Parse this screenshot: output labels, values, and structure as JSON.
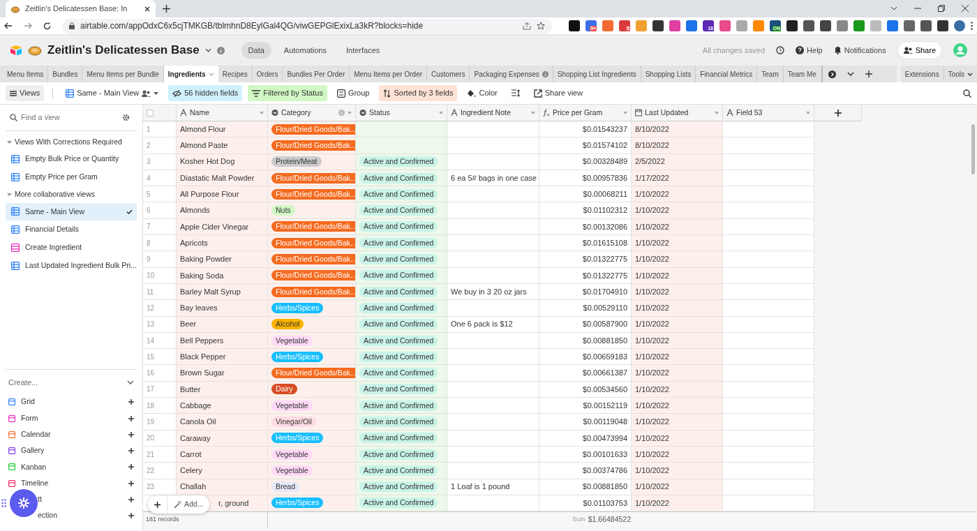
{
  "browser": {
    "tab_title": "Zeitlin's Delicatessen Base: In",
    "url": "airtable.com/appOdxC6x5cjTMKGB/tblmhnD8EylGal4QG/viwGEPGlExixLa3kR?blocks=hide",
    "extensions": [
      {
        "color": "#111111"
      },
      {
        "color": "#3b6ee8",
        "badge": "9+"
      },
      {
        "color": "#f36b32"
      },
      {
        "color": "#d93b3b",
        "badge": "5"
      },
      {
        "color": "#f0a030"
      },
      {
        "color": "#333333"
      },
      {
        "color": "#e040a0"
      },
      {
        "color": "#1a73e8"
      },
      {
        "color": "#5b2bb5",
        "badge": "18"
      },
      {
        "color": "#e84a8a"
      },
      {
        "color": "#aaaaaa"
      },
      {
        "color": "#ff8800"
      },
      {
        "color": "#1a5080",
        "badge": "ON"
      },
      {
        "color": "#222222"
      },
      {
        "color": "#555555"
      },
      {
        "color": "#444444"
      },
      {
        "color": "#888888"
      },
      {
        "color": "#1a9a1a"
      },
      {
        "color": "#bbbbbb"
      },
      {
        "color": "#1a73e8"
      },
      {
        "color": "#666666"
      },
      {
        "color": "#555556"
      },
      {
        "color": "#333334"
      },
      {
        "color": "#3a6ea5"
      }
    ]
  },
  "app": {
    "base_title": "Zeitlin's Delicatessen Base",
    "nav": [
      {
        "label": "Data",
        "selected": true
      },
      {
        "label": "Automations",
        "selected": false
      },
      {
        "label": "Interfaces",
        "selected": false
      }
    ],
    "save_status": "All changes saved",
    "help": "Help",
    "notifications": "Notifications",
    "share": "Share"
  },
  "tables": [
    {
      "label": "Menu Items",
      "selected": false
    },
    {
      "label": "Bundles",
      "selected": false
    },
    {
      "label": "Menu Items per Bundle",
      "selected": false
    },
    {
      "label": "Ingredients",
      "selected": true
    },
    {
      "label": "Recipes",
      "selected": false
    },
    {
      "label": "Orders",
      "selected": false
    },
    {
      "label": "Bundles Per Order",
      "selected": false
    },
    {
      "label": "Menu Items per Order",
      "selected": false
    },
    {
      "label": "Customers",
      "selected": false
    },
    {
      "label": "Packaging Expenses",
      "selected": false,
      "info": true
    },
    {
      "label": "Shopping List Ingredients",
      "selected": false
    },
    {
      "label": "Shopping Lists",
      "selected": false
    },
    {
      "label": "Financial Metrics",
      "selected": false
    },
    {
      "label": "Team",
      "selected": false
    },
    {
      "label": "Team Me",
      "selected": false
    }
  ],
  "table_tools": [
    "Extensions",
    "Tools"
  ],
  "toolbar": {
    "views": "Views",
    "current_view": "Same - Main View",
    "buttons": [
      {
        "kind": "hidden",
        "label": "56 hidden fields"
      },
      {
        "kind": "filter",
        "label": "Filtered by Status"
      },
      {
        "kind": "group",
        "label": "Group"
      },
      {
        "kind": "sort",
        "label": "Sorted by 3 fields"
      },
      {
        "kind": "color",
        "label": "Color"
      },
      {
        "kind": "height"
      },
      {
        "kind": "share",
        "label": "Share view"
      }
    ]
  },
  "sidebar": {
    "search": {
      "placeholder": "Find a view"
    },
    "sections": [
      {
        "title": "Views With Corrections Required",
        "expanded": true,
        "views": [
          {
            "kind": "grid",
            "label": "Empty Bulk Price or Quantity",
            "selected": false
          },
          {
            "kind": "grid",
            "label": "Empty Price per Gram",
            "selected": false
          }
        ]
      },
      {
        "title": "More collaborative views",
        "expanded": true,
        "views": [
          {
            "kind": "grid",
            "label": "Same - Main View",
            "selected": true
          },
          {
            "kind": "grid",
            "label": "Financial Details",
            "selected": false
          },
          {
            "kind": "form",
            "label": "Create Ingredient",
            "selected": false
          },
          {
            "kind": "grid",
            "label": "Last Updated Ingredient Bulk Pri...",
            "selected": false
          }
        ]
      }
    ],
    "create": {
      "title": "Create...",
      "items": [
        {
          "label": "Grid",
          "color": "#2d7ff9"
        },
        {
          "label": "Form",
          "color": "#e929ba"
        },
        {
          "label": "Calendar",
          "color": "#ff6f2c"
        },
        {
          "label": "Gallery",
          "color": "#7c39ed"
        },
        {
          "label": "Kanban",
          "color": "#20c933"
        },
        {
          "label": "Timeline",
          "color": "#f82b60"
        },
        {
          "label": "tt"
        },
        {
          "label": "ection"
        }
      ]
    }
  },
  "table": {
    "columns": [
      {
        "kind": "text",
        "label": "Name"
      },
      {
        "kind": "select",
        "label": "Category",
        "info": true
      },
      {
        "kind": "select",
        "label": "Status"
      },
      {
        "kind": "text",
        "label": "Ingredient Note"
      },
      {
        "kind": "formula",
        "label": "Price per Gram"
      },
      {
        "kind": "date",
        "label": "Last Updated"
      },
      {
        "kind": "text",
        "label": "Field 53"
      }
    ],
    "rows": [
      {
        "number": "1",
        "name": "Almond Flour",
        "category": {
          "label": "Flour/Dried Goods/Bak...",
          "color": "#f56a1f"
        },
        "price": "$0.01543237",
        "updated": "8/10/2022"
      },
      {
        "number": "2",
        "name": "Almond Paste",
        "category": {
          "label": "Flour/Dried Goods/Bak...",
          "color": "#f56a1f"
        },
        "price": "$0.01574102",
        "updated": "8/10/2022"
      },
      {
        "number": "3",
        "name": "Kosher Hot Dog",
        "category": {
          "label": "Protein/Meat",
          "color": "#cccccc"
        },
        "status": "Active and Confirmed",
        "price": "$0.00328489",
        "updated": "2/5/2022"
      },
      {
        "number": "4",
        "name": "Diastatic Malt Powder",
        "category": {
          "label": "Flour/Dried Goods/Bak...",
          "color": "#f56a1f"
        },
        "status": "Active and Confirmed",
        "note": "6 ea 5# bags in one case",
        "price": "$0.00957836",
        "updated": "1/17/2022"
      },
      {
        "number": "5",
        "name": "All Purpose Flour",
        "category": {
          "label": "Flour/Dried Goods/Bak...",
          "color": "#f56a1f"
        },
        "status": "Active and Confirmed",
        "price": "$0.00068211",
        "updated": "1/10/2022"
      },
      {
        "number": "6",
        "name": "Almonds",
        "category": {
          "label": "Nuts",
          "color": "#d1f7c4"
        },
        "status": "Active and Confirmed",
        "price": "$0.01102312",
        "updated": "1/10/2022"
      },
      {
        "number": "7",
        "name": "Apple Cider Vinegar",
        "category": {
          "label": "Flour/Dried Goods/Bak...",
          "color": "#f56a1f"
        },
        "status": "Active and Confirmed",
        "price": "$0.00132086",
        "updated": "1/10/2022"
      },
      {
        "number": "8",
        "name": "Apricots",
        "category": {
          "label": "Flour/Dried Goods/Bak...",
          "color": "#f56a1f"
        },
        "status": "Active and Confirmed",
        "price": "$0.01615108",
        "updated": "1/10/2022"
      },
      {
        "number": "9",
        "name": "Baking Powder",
        "category": {
          "label": "Flour/Dried Goods/Bak...",
          "color": "#f56a1f"
        },
        "status": "Active and Confirmed",
        "price": "$0.01322775",
        "updated": "1/10/2022"
      },
      {
        "number": "10",
        "name": "Baking Soda",
        "category": {
          "label": "Flour/Dried Goods/Bak...",
          "color": "#f56a1f"
        },
        "status": "Active and Confirmed",
        "price": "$0.01322775",
        "updated": "1/10/2022"
      },
      {
        "number": "11",
        "name": "Barley Malt Syrup",
        "category": {
          "label": "Flour/Dried Goods/Bak...",
          "color": "#f56a1f"
        },
        "status": "Active and Confirmed",
        "note": "We buy in 3 20 oz jars",
        "price": "$0.01704910",
        "updated": "1/10/2022"
      },
      {
        "number": "12",
        "name": "Bay leaves",
        "category": {
          "label": "Herbs/Spices",
          "color": "#18bfff"
        },
        "status": "Active and Confirmed",
        "price": "$0.00529110",
        "updated": "1/10/2022"
      },
      {
        "number": "13",
        "name": "Beer",
        "category": {
          "label": "Alcohol",
          "color": "#fcb400"
        },
        "status": "Active and Confirmed",
        "note": "One 6 pack is $12",
        "price": "$0.00587900",
        "updated": "1/10/2022"
      },
      {
        "number": "14",
        "name": "Bell Peppers",
        "category": {
          "label": "Vegetable",
          "color": "#ffdaf6"
        },
        "status": "Active and Confirmed",
        "price": "$0.00881850",
        "updated": "1/10/2022"
      },
      {
        "number": "15",
        "name": "Black Pepper",
        "category": {
          "label": "Herbs/Spices",
          "color": "#18bfff"
        },
        "status": "Active and Confirmed",
        "price": "$0.00659183",
        "updated": "1/10/2022"
      },
      {
        "number": "16",
        "name": "Brown Sugar",
        "category": {
          "label": "Flour/Dried Goods/Bak...",
          "color": "#f56a1f"
        },
        "status": "Active and Confirmed",
        "price": "$0.00661387",
        "updated": "1/10/2022"
      },
      {
        "number": "17",
        "name": "Butter",
        "category": {
          "label": "Dairy",
          "color": "#d74d26"
        },
        "status": "Active and Confirmed",
        "price": "$0.00534560",
        "updated": "1/10/2022"
      },
      {
        "number": "18",
        "name": "Cabbage",
        "category": {
          "label": "Vegetable",
          "color": "#ffdaf6"
        },
        "status": "Active and Confirmed",
        "price": "$0.00152119",
        "updated": "1/10/2022"
      },
      {
        "number": "19",
        "name": "Canola Oil",
        "category": {
          "label": "Vinegar/Oil",
          "color": "#ffdce5"
        },
        "status": "Active and Confirmed",
        "price": "$0.00119048",
        "updated": "1/10/2022"
      },
      {
        "number": "20",
        "name": "Caraway",
        "category": {
          "label": "Herbs/Spices",
          "color": "#18bfff"
        },
        "status": "Active and Confirmed",
        "price": "$0.00473994",
        "updated": "1/10/2022"
      },
      {
        "number": "21",
        "name": "Carrot",
        "category": {
          "label": "Vegetable",
          "color": "#ffdaf6"
        },
        "status": "Active and Confirmed",
        "price": "$0.00101633",
        "updated": "1/10/2022"
      },
      {
        "number": "22",
        "name": "Celery",
        "category": {
          "label": "Vegetable",
          "color": "#ffdaf6"
        },
        "status": "Active and Confirmed",
        "price": "$0.00374786",
        "updated": "1/10/2022"
      },
      {
        "number": "23",
        "name": "Challah",
        "category": {
          "label": "Bread",
          "color": "#e5e9f7"
        },
        "status": "Active and Confirmed",
        "note": "1 Loaf is 1 pound",
        "price": "$0.00881850",
        "updated": "1/10/2022"
      },
      {
        "name": "r, ground",
        "category": {
          "label": "Herbs/Spices",
          "color": "#18bfff"
        },
        "status": "Active and Confirmed",
        "price": "$0.01103753",
        "updated": "1/10/2022"
      }
    ],
    "select_all": {
      "checked": false
    },
    "add_label": "Add...",
    "record_count": "181 records",
    "sum_label": "Sum",
    "sum_value": "$1.66484522"
  }
}
